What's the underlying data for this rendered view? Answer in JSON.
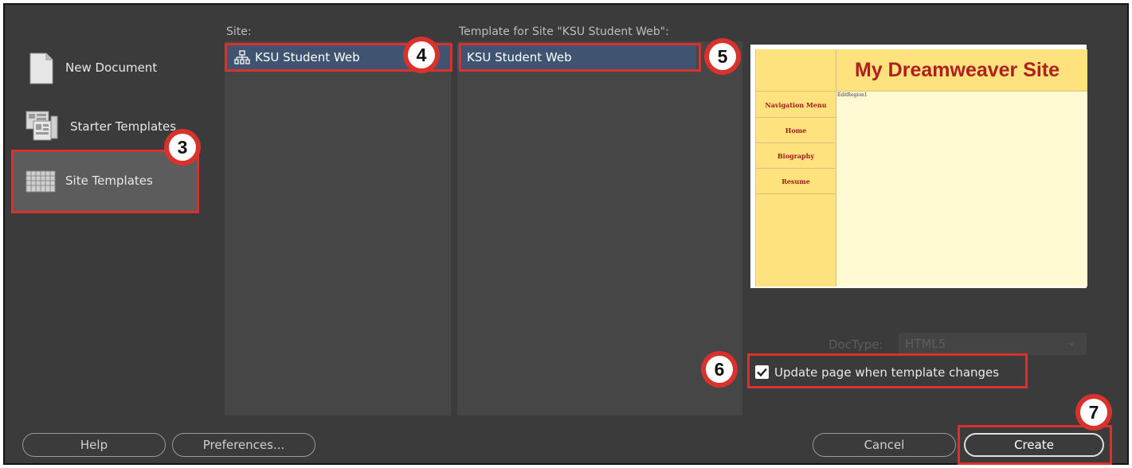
{
  "categories": [
    {
      "label": "New Document",
      "icon": "document-icon"
    },
    {
      "label": "Starter Templates",
      "icon": "starter-templates-icon"
    },
    {
      "label": "Site Templates",
      "icon": "site-templates-icon"
    }
  ],
  "site": {
    "title": "Site:",
    "items": [
      "KSU Student Web"
    ]
  },
  "template": {
    "title": "Template for Site \"KSU Student Web\":",
    "items": [
      "KSU Student Web"
    ]
  },
  "preview": {
    "site_title": "My Dreamweaver Site",
    "nav": [
      "Navigation Menu",
      "Home",
      "Biography",
      "Resume"
    ],
    "editable_region": "EditRegion1"
  },
  "doctype": {
    "label": "DocType:",
    "value": "HTML5"
  },
  "update_checkbox": {
    "label": "Update page when template changes",
    "checked": true
  },
  "buttons": {
    "help": "Help",
    "preferences": "Preferences...",
    "cancel": "Cancel",
    "create": "Create"
  },
  "callouts": [
    "3",
    "4",
    "5",
    "6",
    "7"
  ],
  "colors": {
    "highlight": "#d9322c",
    "selection": "#3e5470",
    "preview_bg": "#fff9d4",
    "preview_sidebar": "#fde27e",
    "preview_title": "#b01f1f"
  }
}
